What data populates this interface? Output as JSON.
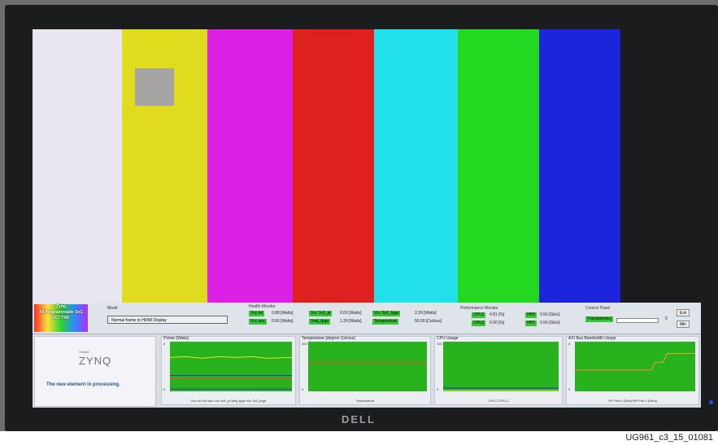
{
  "colors": {
    "bars": [
      "#e9e5f1",
      "#dfdc20",
      "#dc20e4",
      "#de211f",
      "#21e0ea",
      "#24d821",
      "#1c25dc",
      "#1b1b1d"
    ],
    "plot": "#27b21e",
    "line_yellow": "#e7e51c",
    "line_red": "#ff3d30",
    "line_blue": "#1f30e0"
  },
  "logo": {
    "line1": "Zynq",
    "line2": "All Programmable SoC",
    "line3": "ZC7 TRD"
  },
  "mode": {
    "title": "Mode",
    "value": "Normal frame to HDMI Display"
  },
  "health": {
    "title": "Health Monitor",
    "items": [
      {
        "label": "Vcc int",
        "value": "0.88 [Watts]"
      },
      {
        "label": "Vcc aux",
        "value": "0.06 [Watts]"
      },
      {
        "label": "Vcc 1v5_pl",
        "value": "0.02 [Watts]"
      },
      {
        "label": "Vadj_fpga",
        "value": "1.20 [Watts]"
      },
      {
        "label": "Vcc 3v3_fpga",
        "value": "3.39 [Watts]"
      },
      {
        "label": "Temperature",
        "value": "56.00 [Celcius]"
      }
    ]
  },
  "perf": {
    "title": "Performance Monitor",
    "items": [
      {
        "label": "CPU1",
        "value": "4.81 [%]"
      },
      {
        "label": "CPU2",
        "value": "0.00 [%]"
      },
      {
        "label": "HP0",
        "value": "0.56 [Gb/s]"
      },
      {
        "label": "HP2",
        "value": "0.56 [Gb/s]"
      }
    ]
  },
  "control": {
    "title": "Control Panel",
    "transparency_label": "Transparency",
    "slider_value": "0",
    "exit": "Exit",
    "min": "Min"
  },
  "zynq": {
    "small": "XILINX",
    "logo": "ZYNQ",
    "tagline": "The new element in processing."
  },
  "charts": [
    {
      "title": "Power [Watts]",
      "ytop": "6",
      "ybottom": "0",
      "legend": "Vcc int   Vcc aux   Vcc 1v5_pl   Vadj_fpga   Vcc 3v3_fpga"
    },
    {
      "title": "Temperature [degree Celcius]",
      "ytop": "100",
      "ybottom": "0",
      "legend": "Temperature"
    },
    {
      "title": "CPU Usage",
      "ytop": "100",
      "ybottom": "0",
      "legend": "CPU 1  CPU 2"
    },
    {
      "title": "AXI Bus Bandwidth Usage",
      "ytop": "8",
      "ybottom": "0",
      "legend": "HP Port 0 [Gb/s]   HP Port 2 [Gb/s]"
    }
  ],
  "monitor_brand": "DELL",
  "caption": "UG961_c3_15_01081"
}
